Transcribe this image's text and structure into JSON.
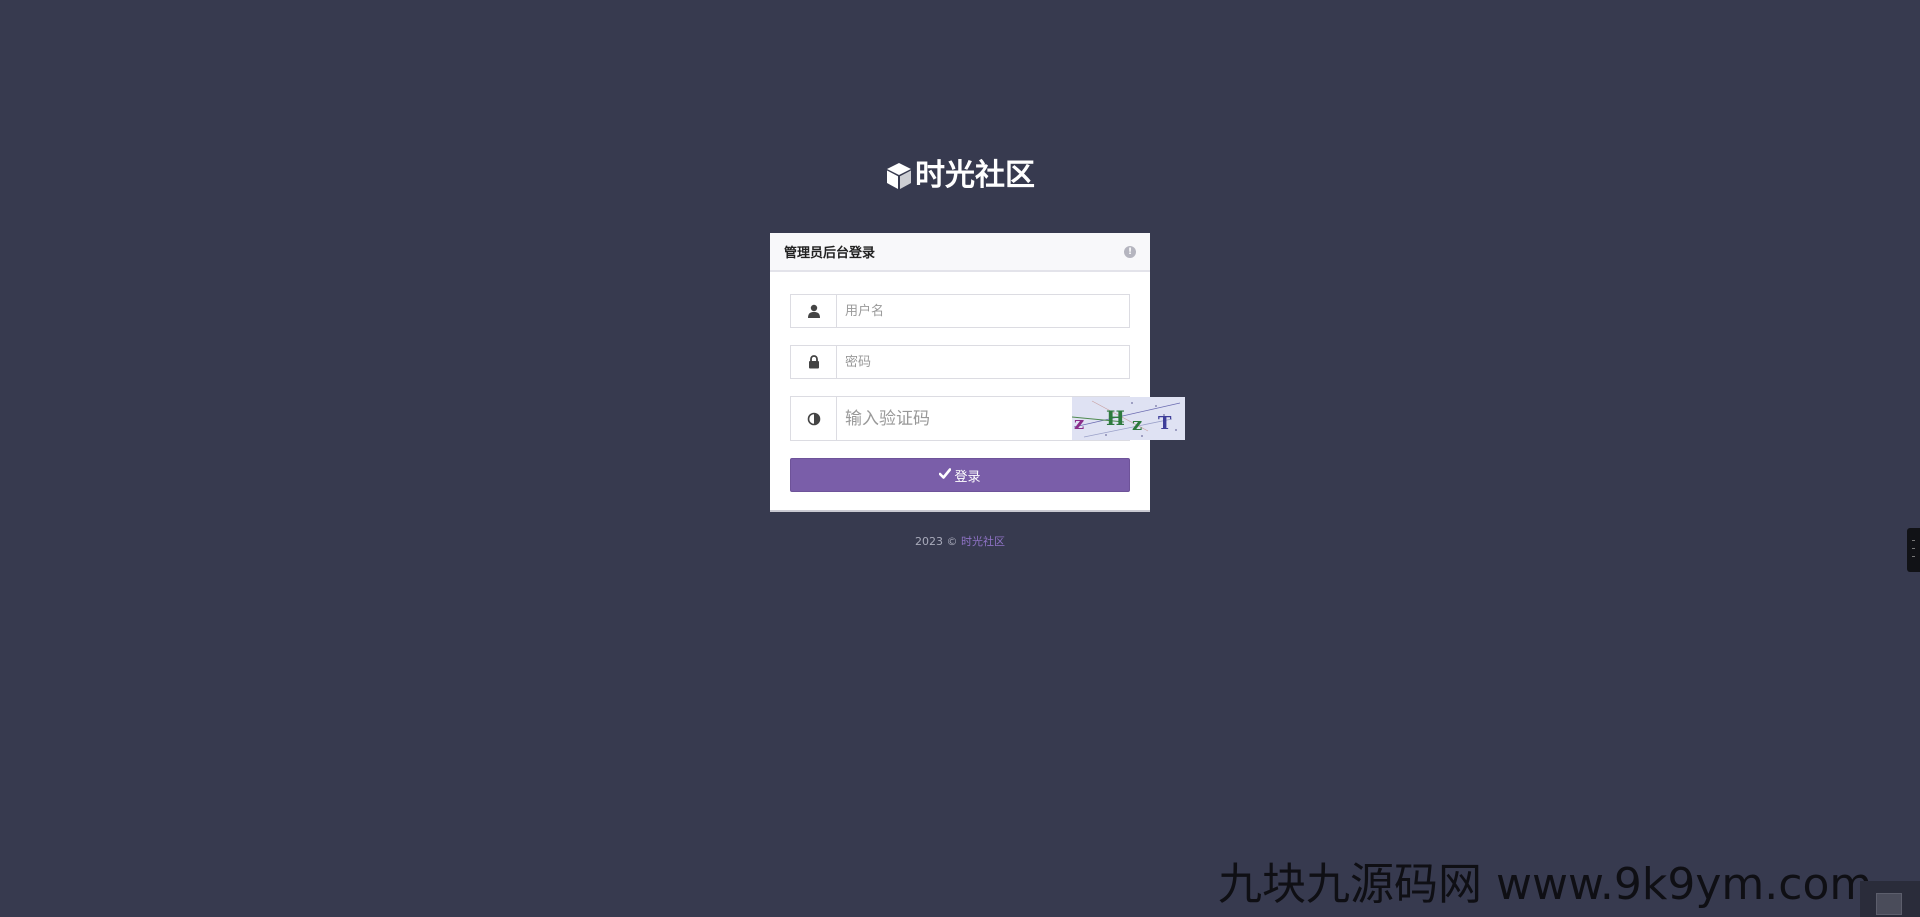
{
  "brand": {
    "name": "时光社区",
    "icon": "cube-icon"
  },
  "panel": {
    "title": "管理员后台登录",
    "info_icon": "info-circle-icon"
  },
  "form": {
    "username": {
      "placeholder": "用户名",
      "value": "",
      "icon": "user-icon"
    },
    "password": {
      "placeholder": "密码",
      "value": "",
      "icon": "lock-icon"
    },
    "captcha": {
      "placeholder": "输入验证码",
      "value": "",
      "icon": "half-circle-icon",
      "image_text": "zHzT"
    },
    "submit": {
      "label": "登录",
      "icon": "check-icon"
    }
  },
  "footer": {
    "copyright": "2023 © ",
    "link": "时光社区"
  },
  "watermark": "九块九源码网 www.9k9ym.com",
  "colors": {
    "background": "#373a4f",
    "accent": "#7a5ea9",
    "link": "#8f73c6"
  }
}
